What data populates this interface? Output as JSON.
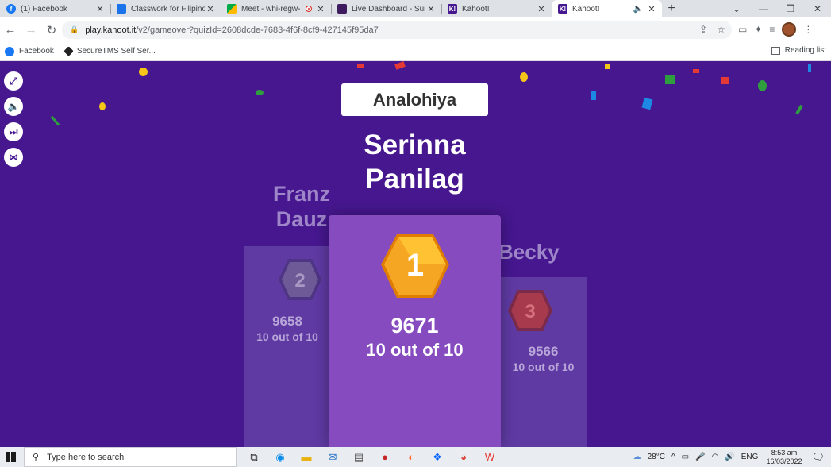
{
  "browser": {
    "tabs": [
      {
        "title": "(1) Facebook",
        "fav_color": "#1877f2",
        "fav_glyph": "f",
        "active": false
      },
      {
        "title": "Classwork for Filipino",
        "fav_color": "#1a73e8",
        "fav_glyph": "",
        "active": false
      },
      {
        "title": "Meet - whi-regw-",
        "fav_color": "#00ac47",
        "fav_glyph": "",
        "active": false,
        "recording": true
      },
      {
        "title": "Live Dashboard - Sum",
        "fav_color": "#3d1b5e",
        "fav_glyph": "",
        "active": false
      },
      {
        "title": "Kahoot!",
        "fav_color": "#46178f",
        "fav_glyph": "K!",
        "active": false
      },
      {
        "title": "Kahoot!",
        "fav_color": "#46178f",
        "fav_glyph": "K!",
        "active": true,
        "audio": true
      }
    ],
    "url_host": "play.kahoot.it",
    "url_rest": "/v2/gameover?quizId=2608dcde-7683-4f6f-8cf9-427145f95da7",
    "bookmarks": [
      {
        "label": "Facebook",
        "color": "#1877f2"
      },
      {
        "label": "SecureTMS Self Ser...",
        "color": "#222222"
      }
    ],
    "reading_list": "Reading list"
  },
  "game": {
    "quiz_title": "Analohiya",
    "first": {
      "name_line1": "Serinna",
      "name_line2": "Panilag",
      "rank": "1",
      "score": "9671",
      "correct": "10 out of 10"
    },
    "second": {
      "name_line1": "Franz",
      "name_line2": "Dauz",
      "rank": "2",
      "score": "9658",
      "correct": "10 out of 10"
    },
    "third": {
      "name": "Becky",
      "rank": "3",
      "score": "9566",
      "correct": "10 out of 10"
    },
    "colors": {
      "background": "#46178f",
      "podium_side": "#5f3aa3",
      "podium_center": "#864cbf",
      "gold": "#f5a623",
      "silver": "#6e5a96",
      "bronze": "#c0392b"
    }
  },
  "taskbar": {
    "search_placeholder": "Type here to search",
    "weather": "28°C",
    "language": "ENG",
    "time": "8:53 am",
    "date": "16/03/2022"
  }
}
